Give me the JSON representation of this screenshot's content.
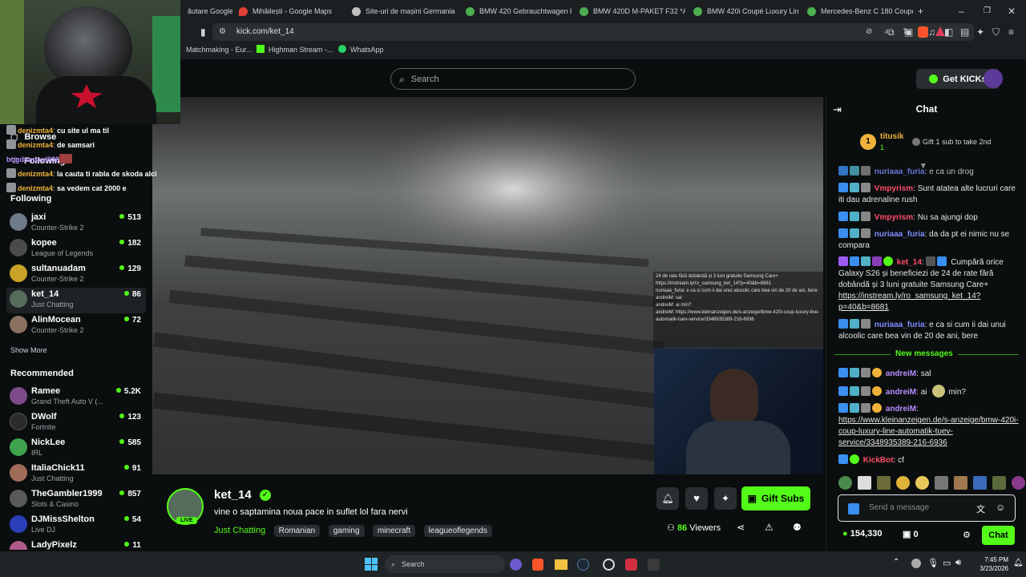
{
  "browser": {
    "tabs": [
      {
        "label": "ăutare Google",
        "color": "#4a4a4a"
      },
      {
        "label": "Mihăilești - Google Maps",
        "color": "#e04135"
      },
      {
        "label": "Site-uri de mașini Germania",
        "color": "#c0c0c0"
      },
      {
        "label": "BMW 420 Gebrauchtwagen ka",
        "color": "#4caf50"
      },
      {
        "label": "BMW 420D M-PAKET F32 *ALC",
        "color": "#4caf50"
      },
      {
        "label": "BMW 420i Coupé Luxury Line",
        "color": "#4caf50"
      },
      {
        "label": "Mercedes-Benz C 180 Coupé",
        "color": "#4caf50"
      }
    ],
    "url": "kick.com/ket_14",
    "bookmarks": [
      "Matchmaking - Eur...",
      "Highman Stream -...",
      "WhatsApp"
    ]
  },
  "nav": {
    "search_placeholder": "Search",
    "get_kicks": "Get KICKs"
  },
  "sidebar": {
    "browse": "Browse",
    "following_overlay": "Following",
    "following_title": "Following",
    "following": [
      {
        "name": "jaxi",
        "game": "Counter-Strike 2",
        "viewers": "513",
        "color": "#6f7b8a"
      },
      {
        "name": "kopee",
        "game": "League of Legends",
        "viewers": "182",
        "color": "#4b4b4b"
      },
      {
        "name": "sultanuadam",
        "game": "Counter-Strike 2",
        "viewers": "129",
        "color": "#c9a227"
      },
      {
        "name": "ket_14",
        "game": "Just Chatting",
        "viewers": "86",
        "color": "#556b5b"
      },
      {
        "name": "AlinMocean",
        "game": "Counter-Strike 2",
        "viewers": "72",
        "color": "#8a7060"
      }
    ],
    "show_more": "Show More",
    "recommended_title": "Recommended",
    "recommended": [
      {
        "name": "Ramee",
        "game": "Grand Theft Auto V (...",
        "viewers": "5.2K",
        "color": "#7d4b8a"
      },
      {
        "name": "DWolf",
        "game": "Fortnite",
        "viewers": "123",
        "color": "#2b2b2b"
      },
      {
        "name": "NickLee",
        "game": "IRL",
        "viewers": "585",
        "color": "#3fa34d"
      },
      {
        "name": "ItaliaChick11",
        "game": "Just Chatting",
        "viewers": "91",
        "color": "#a06c5a"
      },
      {
        "name": "TheGambler1999",
        "game": "Slots & Casino",
        "viewers": "857",
        "color": "#5a5a5a"
      },
      {
        "name": "DJMissShelton",
        "game": "Live DJ",
        "viewers": "54",
        "color": "#2a3fb8"
      },
      {
        "name": "LadyPixelz",
        "game": "",
        "viewers": "11",
        "color": "#b05a8a"
      }
    ]
  },
  "overlay_chat": [
    {
      "user": "denizmta4",
      "text": "cu site ul ma til"
    },
    {
      "user": "denizmta4",
      "text": "de samsari"
    },
    {
      "user": "bogdanpaul900",
      "text": ""
    },
    {
      "user": "denizmta4",
      "text": "la cauta ti rabla de skoda alci"
    },
    {
      "user": "denizmta4",
      "text": "sa vedem cat 2000 e"
    }
  ],
  "stream": {
    "channel": "ket_14",
    "live": "LIVE",
    "title": "vine o saptamina noua pace in suflet lol fara nervi",
    "category": "Just Chatting",
    "tags": [
      "Romanian",
      "gaming",
      "minecraft",
      "leagueoflegends"
    ],
    "viewers_count": "86",
    "viewers_label": "Viewers",
    "gift_subs": "Gift Subs"
  },
  "chat": {
    "title": "Chat",
    "leader": {
      "rank": "1",
      "name": "titusik",
      "subs": "1",
      "gift_text": "Gift 1 sub to take 2nd"
    },
    "messages": [
      {
        "user": "nuriaaa_furia",
        "color": "#7f8cff",
        "text": "e ca un drog"
      },
      {
        "user": "Vmpyrism",
        "color": "#ff4d6a",
        "text": "Sunt atatea alte lucruri care iti dau adrenaline rush"
      },
      {
        "user": "Vmpyrism",
        "color": "#ff4d6a",
        "text": "Nu sa ajungi dop"
      },
      {
        "user": "nuriaaa_furia",
        "color": "#7f8cff",
        "text": "da da pt ei nimic nu se compara"
      },
      {
        "user": "ket_14",
        "color": "#ff4d6a",
        "text": "Cumpără orice Galaxy S26 și beneficiezi de 24 de rate fără dobândă și 3 luni gratuite Samsung Care+",
        "link": "https://instream.ly/ro_samsung_ket_14?p=40&b=8681"
      },
      {
        "user": "nuriaaa_furia",
        "color": "#7f8cff",
        "text": "e ca si cum ii dai unui alcoolic care bea vin de 20 de ani, bere"
      }
    ],
    "new_messages": "New messages",
    "new": [
      {
        "user": "andreiM",
        "color": "#b58cff",
        "text": "sal"
      },
      {
        "user": "andreiM",
        "color": "#b58cff",
        "text": "ai",
        "after": "min?"
      },
      {
        "user": "andreiM",
        "color": "#b58cff",
        "text": "",
        "link": "https://www.kleinanzeigen.de/s-anzeige/bmw-420i-coup-luxury-line-automatik-tuev-service/3348935389-216-6936"
      },
      {
        "user": "KickBot",
        "color": "#ff4d6a",
        "text": "cf"
      }
    ],
    "input_placeholder": "Send a message",
    "kicks_balance": "154,330",
    "gifts_count": "0",
    "send": "Chat"
  },
  "overlay_video_chat": [
    {
      "text": "24 de rate fără dobândă și 3 luni gratuite Samsung Care+"
    },
    {
      "text": "https://instream.ly/ro_samsung_ket_14?p=40&b=8681"
    },
    {
      "text": "nuriaaa_furia: e ca si cum ii dai unui alcoolic care bea vin de 20 de ani, bere"
    },
    {
      "text": "andreiM: sal"
    },
    {
      "text": "andreiM: ai     min?"
    },
    {
      "text": "andreiM: https://www.kleinanzeigen.de/s-anzeige/bmw-420i-coup-luxury-line-automatik-tuev-service/3348935389-216-6936"
    }
  ],
  "taskbar": {
    "search": "Search",
    "time": "7:45 PM",
    "date": "3/23/2026"
  },
  "colors": {
    "accent": "#53fc18",
    "bg": "#0b0e0f"
  }
}
